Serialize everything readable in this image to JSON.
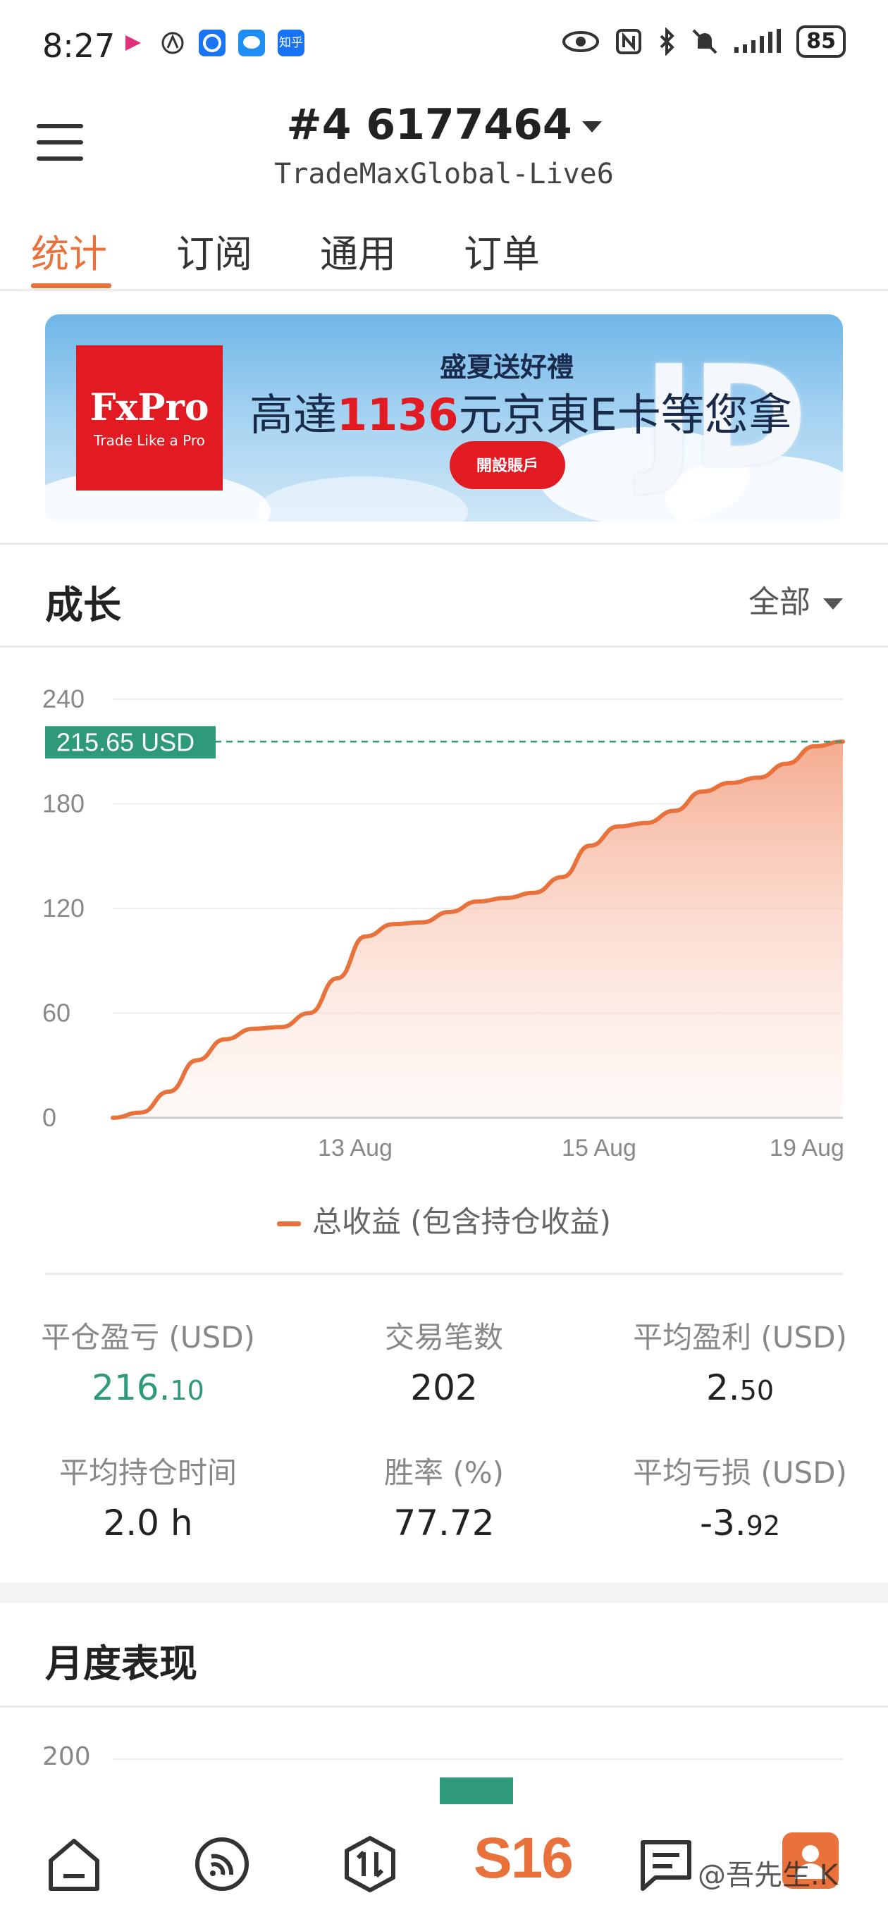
{
  "status_bar": {
    "time": "8:27",
    "battery": "85"
  },
  "header": {
    "account_title": "#4  6177464",
    "server": "TradeMaxGlobal-Live6"
  },
  "tabs": [
    "统计",
    "订阅",
    "通用",
    "订单"
  ],
  "banner": {
    "logo": "FxPro",
    "logo_tagline": "Trade Like a Pro",
    "headline": "盛夏送好禮",
    "main_pre": "高達",
    "main_amount": "1136",
    "main_post": "元京東E卡等您拿",
    "button": "開設賬戶",
    "jd_mark": "JD"
  },
  "growth": {
    "title": "成长",
    "filter": "全部",
    "current_label": "215.65 USD",
    "legend": "总收益 (包含持仓收益)"
  },
  "chart_data": {
    "type": "area",
    "yticks": [
      240,
      180,
      120,
      60,
      0
    ],
    "xticks": [
      "13 Aug",
      "15 Aug",
      "19 Aug"
    ],
    "ylim": [
      0,
      240
    ],
    "series": [
      {
        "name": "总收益 (包含持仓收益)",
        "color": "#e8713c",
        "values": [
          0,
          3,
          15,
          33,
          45,
          51,
          52,
          60,
          80,
          104,
          111,
          112,
          118,
          124,
          126,
          129,
          138,
          156,
          167,
          169,
          176,
          187,
          192,
          195,
          203,
          213,
          215.65
        ]
      }
    ],
    "reference_value": 215.65
  },
  "stats": [
    {
      "label": "平仓盈亏 (USD)",
      "value_main": "216.",
      "value_small": "10",
      "color": "green"
    },
    {
      "label": "交易笔数",
      "value_main": "202",
      "value_small": ""
    },
    {
      "label": "平均盈利 (USD)",
      "value_main": "2.",
      "value_small": "50"
    },
    {
      "label": "平均持仓时间",
      "value_main": "2.0 h",
      "value_small": ""
    },
    {
      "label": "胜率 (%)",
      "value_main": "77.72",
      "value_small": ""
    },
    {
      "label": "平均亏损 (USD)",
      "value_main": "-3.",
      "value_small": "92"
    }
  ],
  "monthly": {
    "title": "月度表现",
    "ytick": "200",
    "bar_color": "#2e9a7a"
  },
  "bottom_nav": [
    "home-icon",
    "rss-icon",
    "trade-icon",
    "s16-logo",
    "messages-icon",
    "profile-icon"
  ],
  "nav_logo": "S16",
  "watermark": "@吾先生.K"
}
